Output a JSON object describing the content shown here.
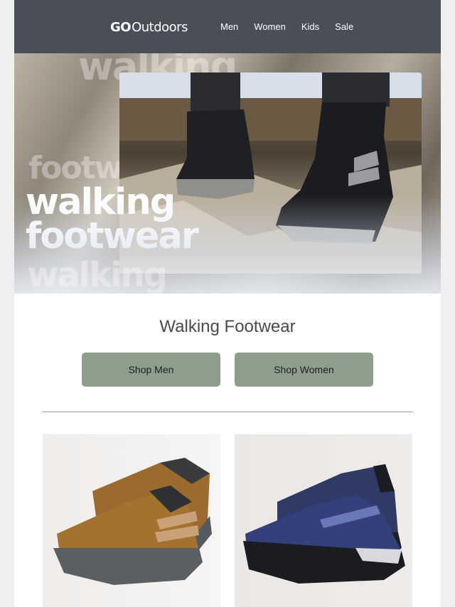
{
  "header": {
    "logo": {
      "go": "GO",
      "rest": "Outdoors"
    },
    "nav": [
      "Men",
      "Women",
      "Kids",
      "Sale"
    ]
  },
  "hero": {
    "title_line1": "walking",
    "title_line2": "footwear",
    "ghost_top": "walking",
    "ghost_mid": "footw",
    "ghost_bottom": "walking"
  },
  "section": {
    "title": "Walking Footwear",
    "buttons": [
      "Shop Men",
      "Shop Women"
    ]
  },
  "colors": {
    "header_bg": "#4a4e57",
    "button_bg": "#8e9e8c",
    "shoe1_upper": "#9a6a2e",
    "shoe2_upper": "#2f3a66"
  },
  "products": [
    {
      "icon": "hiking-shoe-tan-icon"
    },
    {
      "icon": "hiking-shoe-navy-icon"
    }
  ]
}
